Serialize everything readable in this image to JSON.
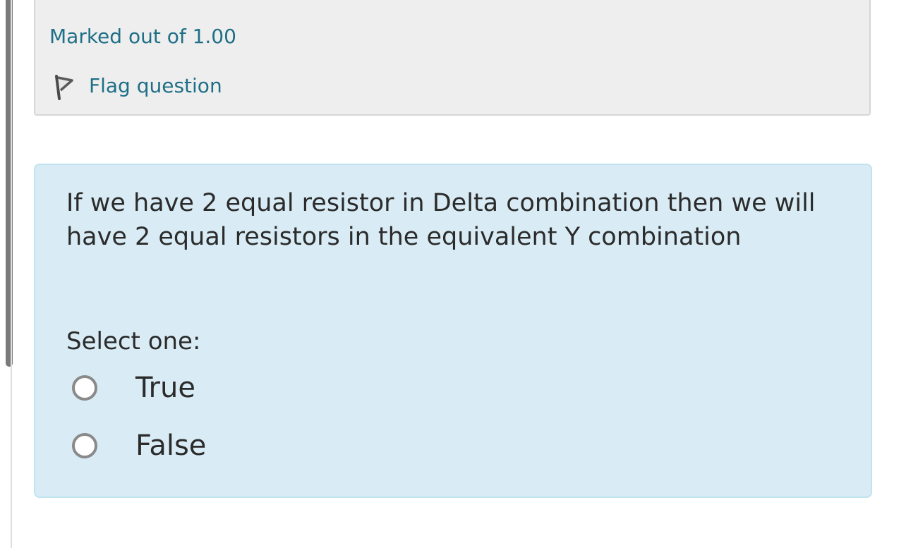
{
  "question_info": {
    "marks": "Marked out of 1.00",
    "flag_label": "Flag question",
    "icon": "flag-icon"
  },
  "question": {
    "text": "If we have 2 equal resistor in Delta combination then we will have 2 equal resistors in the equivalent Y combination",
    "prompt": "Select one:",
    "options": [
      {
        "label": "True",
        "selected": false
      },
      {
        "label": "False",
        "selected": false
      }
    ]
  },
  "colors": {
    "link": "#1f6f87",
    "info_background": "#eeeeee",
    "question_background": "#d9ecf5",
    "question_border": "#bfe4ee"
  }
}
